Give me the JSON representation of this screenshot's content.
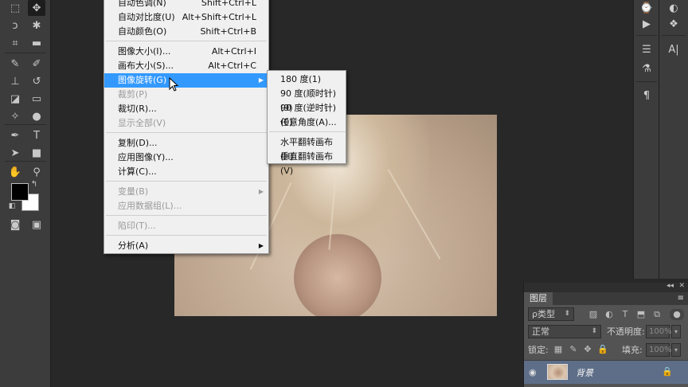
{
  "image_menu": {
    "items": [
      {
        "label": "自动色调(N)",
        "shortcut": "Shift+Ctrl+L",
        "disabled": false
      },
      {
        "label": "自动对比度(U)",
        "shortcut": "Alt+Shift+Ctrl+L",
        "disabled": false
      },
      {
        "label": "自动颜色(O)",
        "shortcut": "Shift+Ctrl+B",
        "disabled": false
      },
      {
        "label": "图像大小(I)...",
        "shortcut": "Alt+Ctrl+I",
        "disabled": false
      },
      {
        "label": "画布大小(S)...",
        "shortcut": "Alt+Ctrl+C",
        "disabled": false
      },
      {
        "label": "图像旋转(G)",
        "shortcut": "",
        "disabled": false,
        "highlighted": true,
        "has_submenu": true
      },
      {
        "label": "裁剪(P)",
        "shortcut": "",
        "disabled": true
      },
      {
        "label": "裁切(R)...",
        "shortcut": "",
        "disabled": false
      },
      {
        "label": "显示全部(V)",
        "shortcut": "",
        "disabled": true
      },
      {
        "label": "复制(D)...",
        "shortcut": "",
        "disabled": false
      },
      {
        "label": "应用图像(Y)...",
        "shortcut": "",
        "disabled": false
      },
      {
        "label": "计算(C)...",
        "shortcut": "",
        "disabled": false
      },
      {
        "label": "变量(B)",
        "shortcut": "",
        "disabled": true,
        "has_submenu": true
      },
      {
        "label": "应用数据组(L)...",
        "shortcut": "",
        "disabled": true
      },
      {
        "label": "陷印(T)...",
        "shortcut": "",
        "disabled": true
      },
      {
        "label": "分析(A)",
        "shortcut": "",
        "disabled": false,
        "has_submenu": true
      }
    ]
  },
  "rotation_submenu": {
    "items": [
      {
        "label": "180 度(1)"
      },
      {
        "label": "90 度(顺时针)(9)"
      },
      {
        "label": "90 度(逆时针)(0)"
      },
      {
        "label": "任意角度(A)..."
      },
      {
        "label": "水平翻转画布(H)"
      },
      {
        "label": "垂直翻转画布(V)"
      }
    ]
  },
  "layers_panel": {
    "tab": "图层",
    "filter_kind": "ρ类型",
    "blend_mode": "正常",
    "opacity_label": "不透明度:",
    "opacity_value": "100%",
    "lock_label": "锁定:",
    "fill_label": "填充:",
    "fill_value": "100%",
    "layer_name": "背景"
  },
  "dock": {
    "text_icon_label": "A|"
  },
  "colors": {
    "menu_highlight": "#3399ff",
    "selected_layer": "#5e6e88",
    "workspace": "#282828",
    "panel": "#535353"
  }
}
